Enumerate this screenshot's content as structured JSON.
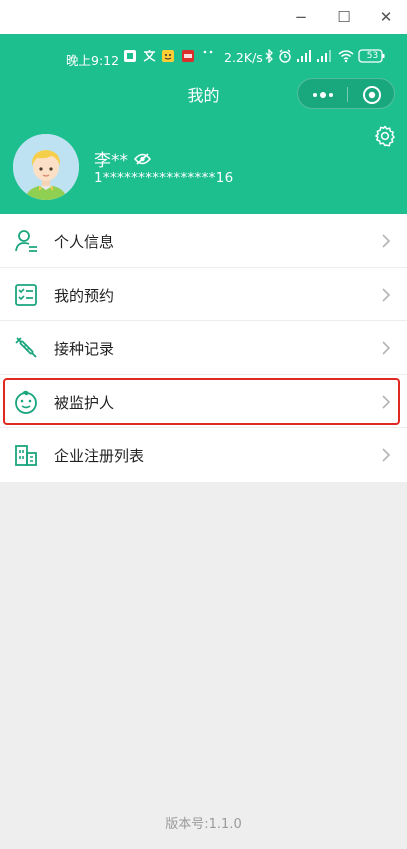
{
  "window": {
    "minimize_glyph": "−",
    "maximize_glyph": "☐",
    "close_glyph": "✕"
  },
  "status_bar": {
    "time": "晚上9:12",
    "network_speed": "2.2K/s",
    "battery": "53"
  },
  "header": {
    "title": "我的"
  },
  "user": {
    "name": "李**",
    "id_masked": "1****************16"
  },
  "menu": {
    "items": [
      {
        "label": "个人信息",
        "icon": "person-icon"
      },
      {
        "label": "我的预约",
        "icon": "checklist-icon"
      },
      {
        "label": "接种记录",
        "icon": "syringe-icon"
      },
      {
        "label": "被监护人",
        "icon": "child-face-icon"
      },
      {
        "label": "企业注册列表",
        "icon": "building-icon"
      }
    ]
  },
  "footer": {
    "version": "版本号:1.1.0"
  },
  "colors": {
    "brand_green": "#1dbf8f",
    "highlight_red": "#e02a21",
    "icon_teal": "#1aa57e"
  }
}
